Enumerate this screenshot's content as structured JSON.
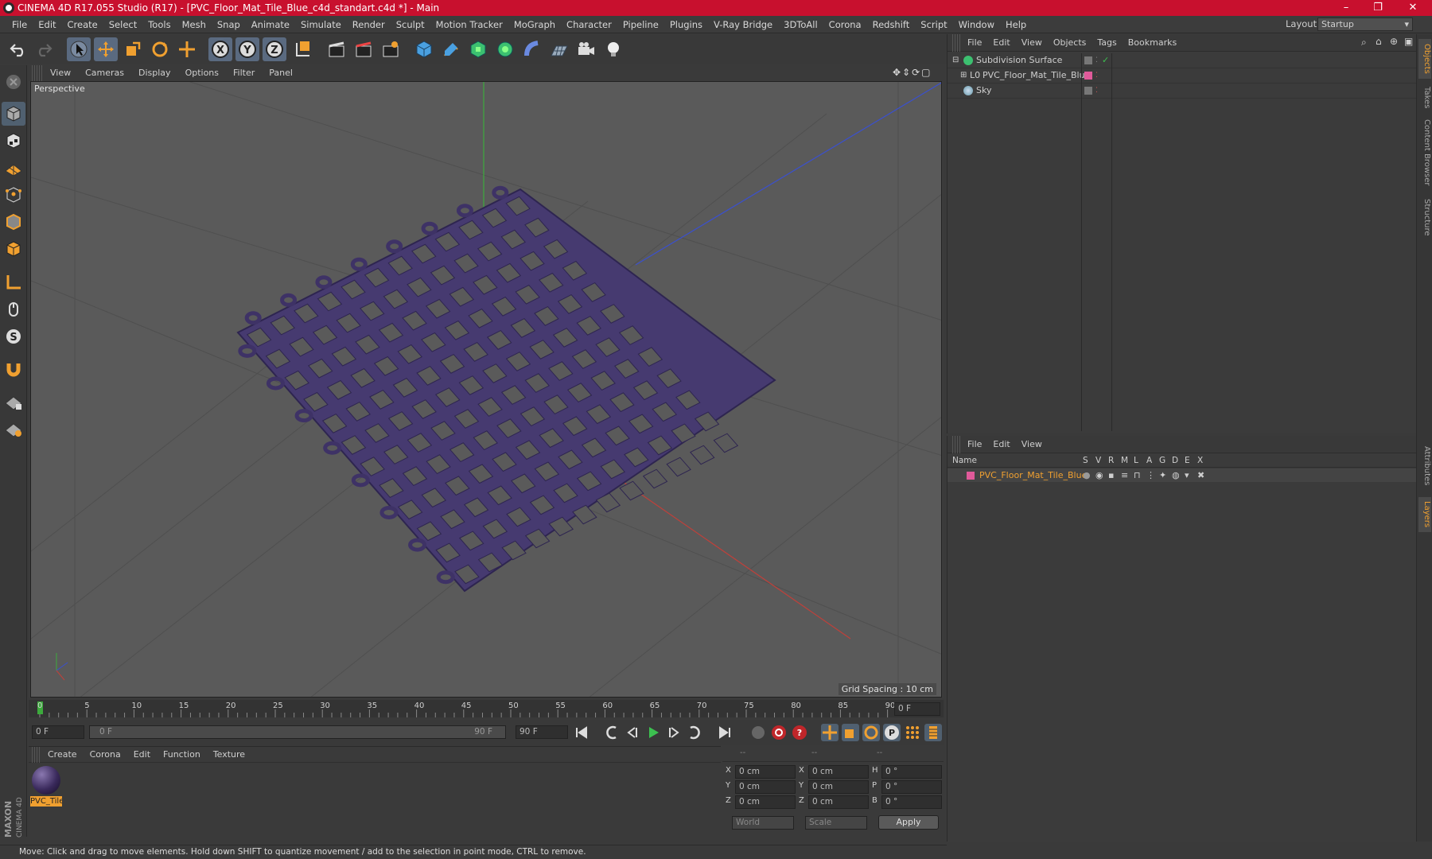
{
  "window": {
    "title": "CINEMA 4D R17.055 Studio (R17) - [PVC_Floor_Mat_Tile_Blue_c4d_standart.c4d *] - Main",
    "minimize": "–",
    "maximize": "❐",
    "close": "✕"
  },
  "menubar": {
    "items": [
      "File",
      "Edit",
      "Create",
      "Select",
      "Tools",
      "Mesh",
      "Snap",
      "Animate",
      "Simulate",
      "Render",
      "Sculpt",
      "Motion Tracker",
      "MoGraph",
      "Character",
      "Pipeline",
      "Plugins",
      "V-Ray Bridge",
      "3DToAll",
      "Corona",
      "Redshift",
      "Script",
      "Window",
      "Help"
    ],
    "layout_label": "Layout:",
    "layout_value": "Startup"
  },
  "viewport": {
    "menu": [
      "View",
      "Cameras",
      "Display",
      "Options",
      "Filter",
      "Panel"
    ],
    "label": "Perspective",
    "grid_spacing": "Grid Spacing : 10 cm"
  },
  "timeline": {
    "ticks": [
      "0",
      "5",
      "10",
      "15",
      "20",
      "25",
      "30",
      "35",
      "40",
      "45",
      "50",
      "55",
      "60",
      "65",
      "70",
      "75",
      "80",
      "85",
      "90"
    ],
    "end_field": "0 F"
  },
  "playbar": {
    "current": "0 F",
    "range_start": "0 F",
    "range_end": "90 F",
    "max": "90 F"
  },
  "material_panel": {
    "menu": [
      "Create",
      "Corona",
      "Edit",
      "Function",
      "Texture"
    ],
    "material_name": "PVC_Tile"
  },
  "coords": {
    "headers": [
      "--",
      "--",
      "--"
    ],
    "rows": [
      {
        "a": "X",
        "av": "0 cm",
        "b": "X",
        "bv": "0 cm",
        "c": "H",
        "cv": "0 °"
      },
      {
        "a": "Y",
        "av": "0 cm",
        "b": "Y",
        "bv": "0 cm",
        "c": "P",
        "cv": "0 °"
      },
      {
        "a": "Z",
        "av": "0 cm",
        "b": "Z",
        "bv": "0 cm",
        "c": "B",
        "cv": "0 °"
      }
    ],
    "world": "World",
    "scale": "Scale",
    "apply": "Apply"
  },
  "object_manager": {
    "menu": [
      "File",
      "Edit",
      "View",
      "Objects",
      "Tags",
      "Bookmarks"
    ],
    "objects": [
      "Subdivision Surface",
      "PVC_Floor_Mat_Tile_Blue",
      "Sky"
    ]
  },
  "layer_manager": {
    "menu": [
      "File",
      "Edit",
      "View"
    ],
    "columns": [
      "Name",
      "S",
      "V",
      "R",
      "M",
      "L",
      "A",
      "G",
      "D",
      "E",
      "X"
    ],
    "layer_name": "PVC_Floor_Mat_Tile_Blue"
  },
  "right_tabs": [
    "Objects",
    "Takes",
    "Content Browser",
    "Structure",
    "Attributes",
    "Layers"
  ],
  "status": "Move: Click and drag to move elements. Hold down SHIFT to quantize movement / add to the selection in point mode, CTRL to remove.",
  "maxon_logo": "MAXON CINEMA 4D",
  "colors": {
    "title_bar": "#c8102e",
    "accent": "#f0a030",
    "layer_color": "#e05a9a",
    "mat": "#5a3c8c"
  }
}
